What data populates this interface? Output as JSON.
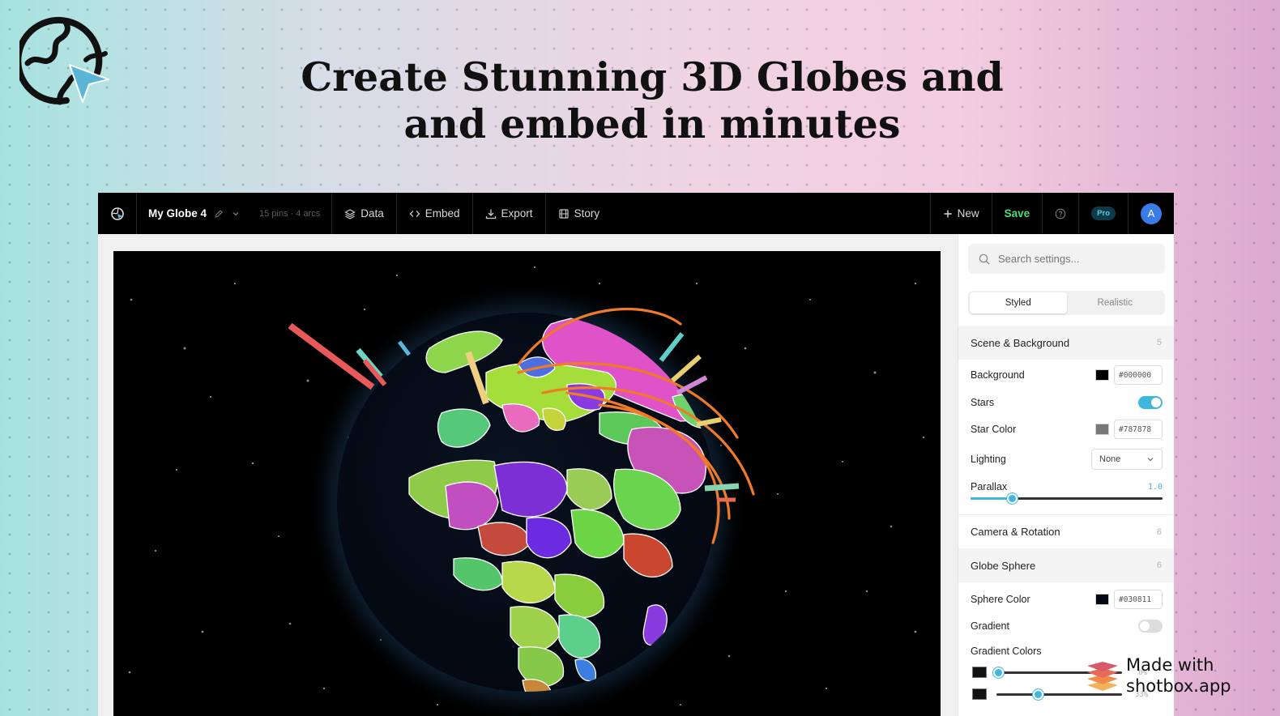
{
  "headline": {
    "line1": "Create Stunning 3D Globes and",
    "line2": "and embed in minutes"
  },
  "toolbar": {
    "globe_name": "My Globe 4",
    "meta": "15 pins · 4 arcs",
    "data_label": "Data",
    "embed_label": "Embed",
    "export_label": "Export",
    "story_label": "Story",
    "new_label": "New",
    "save_label": "Save",
    "pro_label": "Pro",
    "avatar_initial": "A"
  },
  "panel": {
    "search_placeholder": "Search settings...",
    "tabs": [
      "Styled",
      "Realistic"
    ],
    "sections": [
      {
        "title": "Scene & Background",
        "count": "5"
      },
      {
        "title": "Camera & Rotation",
        "count": "6"
      },
      {
        "title": "Globe Sphere",
        "count": "6"
      }
    ],
    "background": {
      "label": "Background",
      "hex": "#000000"
    },
    "stars": {
      "label": "Stars",
      "enabled": true
    },
    "star_color": {
      "label": "Star Color",
      "hex": "#787878"
    },
    "lighting": {
      "label": "Lighting",
      "value": "None"
    },
    "parallax": {
      "label": "Parallax",
      "value": "1.0",
      "fraction": 0.22
    },
    "sphere_color": {
      "label": "Sphere Color",
      "hex": "#030811"
    },
    "gradient": {
      "label": "Gradient",
      "enabled": false
    },
    "gradient_colors": {
      "label": "Gradient Colors",
      "stops": [
        {
          "label": "0%",
          "value": 0.0
        },
        {
          "label": "33%",
          "value": 0.33
        }
      ]
    }
  },
  "colors": {
    "accent": "#3fb6dd",
    "save": "#4ade80",
    "toolbar_bg": "#000000"
  },
  "watermark": {
    "line1": "Made with",
    "line2": "shotbox.app"
  }
}
